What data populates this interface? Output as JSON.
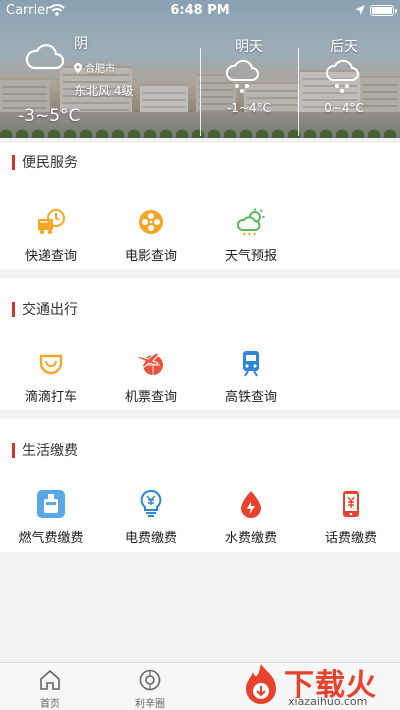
{
  "status_bar": {
    "carrier": "Carrier",
    "time": "6:48 PM"
  },
  "weather": {
    "today": {
      "condition": "阴",
      "city": "合肥市",
      "wind": "东北风 4级",
      "temp": "-3~5°C",
      "icon": "cloud-icon"
    },
    "tomorrow": {
      "label": "明天",
      "temp": "-1~4°C",
      "icon": "snow-cloud-icon"
    },
    "day_after": {
      "label": "后天",
      "temp": "0~4°C",
      "icon": "snow-cloud-icon"
    }
  },
  "sections": [
    {
      "title": "便民服务",
      "items": [
        {
          "label": "快递查询",
          "icon": "express-delivery-icon",
          "color": "#f5a623"
        },
        {
          "label": "电影查询",
          "icon": "film-reel-icon",
          "color": "#f5a623"
        },
        {
          "label": "天气预报",
          "icon": "weather-forecast-icon",
          "color": "#5cb85c"
        }
      ]
    },
    {
      "title": "交通出行",
      "items": [
        {
          "label": "滴滴打车",
          "icon": "didi-taxi-icon",
          "color": "#f5a623"
        },
        {
          "label": "机票查询",
          "icon": "airplane-ticket-icon",
          "color": "#e8543e"
        },
        {
          "label": "高铁查询",
          "icon": "train-icon",
          "color": "#2f86d6"
        }
      ]
    },
    {
      "title": "生活缴费",
      "items": [
        {
          "label": "燃气费缴费",
          "icon": "gas-bill-icon",
          "color": "#5aa9e6"
        },
        {
          "label": "电费缴费",
          "icon": "electricity-bill-icon",
          "color": "#2f86d6"
        },
        {
          "label": "水费缴费",
          "icon": "water-bill-icon",
          "color": "#e8412c"
        },
        {
          "label": "话费缴费",
          "icon": "phone-bill-icon",
          "color": "#e8412c"
        }
      ]
    }
  ],
  "tabbar": [
    {
      "label": "首页",
      "icon": "home-icon"
    },
    {
      "label": "利辛圈",
      "icon": "circle-community-icon"
    }
  ],
  "watermark": {
    "text": "下载火",
    "url": "xiazaihuo.com"
  },
  "colors": {
    "accent": "#d0322c",
    "orange": "#f5a623",
    "blue": "#2f86d6",
    "red": "#e8412c"
  }
}
